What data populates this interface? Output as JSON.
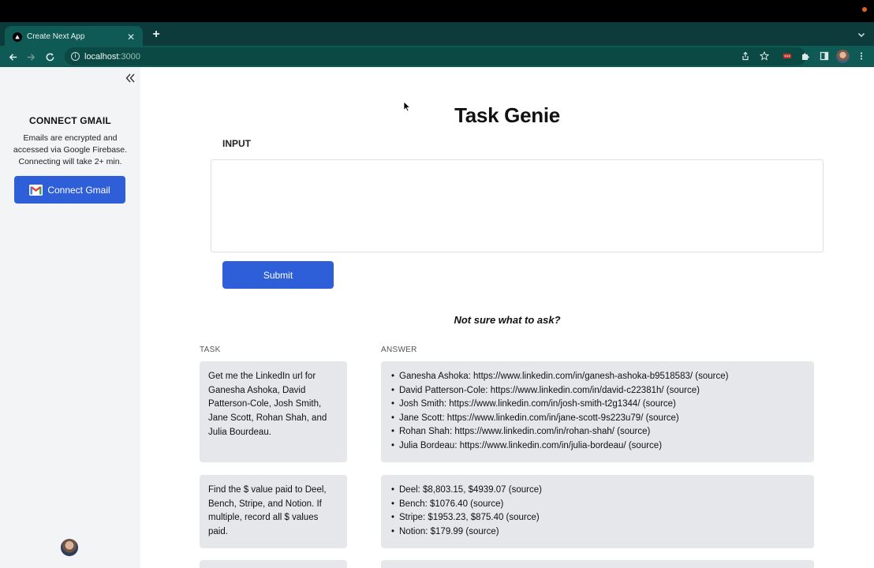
{
  "browser": {
    "tab_title": "Create Next App",
    "url_host": "localhost",
    "url_port": ":3000"
  },
  "sidebar": {
    "title": "CONNECT GMAIL",
    "description": "Emails are encrypted and accessed via Google Firebase. Connecting will take 2+ min.",
    "connect_button": "Connect Gmail"
  },
  "main": {
    "title": "Task Genie",
    "input_label": "INPUT",
    "input_value": "",
    "submit_label": "Submit",
    "hint": "Not sure what to ask?",
    "task_header": "TASK",
    "answer_header": "ANSWER",
    "examples": [
      {
        "task": "Get me the LinkedIn url for Ganesha Ashoka, David Patterson-Cole, Josh Smith, Jane Scott, Rohan Shah, and Julia Bourdeau.",
        "answers": [
          "Ganesha Ashoka: https://www.linkedin.com/in/ganesh-ashoka-b9518583/ (source)",
          "David Patterson-Cole: https://www.linkedin.com/in/david-c22381h/ (source)",
          "Josh Smith: https://www.linkedin.com/in/josh-smith-t2g1344/ (source)",
          "Jane Scott: https://www.linkedin.com/in/jane-scott-9s223u79/ (source)",
          "Rohan Shah: https://www.linkedin.com/in/rohan-shah/ (source)",
          "Julia Bordeau: https://www.linkedin.com/in/julia-bordeau/ (source)"
        ]
      },
      {
        "task": "Find the $ value paid to Deel, Bench, Stripe, and Notion. If multiple, record all $ values paid.",
        "answers": [
          "Deel: $8,803.15, $4939.07 (source)",
          "Bench: $1076.40 (source)",
          "Stripe: $1953.23, $875.40 (source)",
          "Notion: $179.99 (source)"
        ]
      }
    ]
  },
  "colors": {
    "accent": "#2f5fd8",
    "tab_bar": "#0d3b3b",
    "toolbar": "#0f5a55",
    "sidebar_bg": "#f3f4f6",
    "card_bg": "#e5e7eb"
  },
  "icons": [
    "nextjs-favicon",
    "close-icon",
    "plus-icon",
    "chevron-down-icon",
    "back-arrow-icon",
    "forward-arrow-icon",
    "reload-icon",
    "info-icon",
    "share-icon",
    "star-icon",
    "extension-icon",
    "puzzle-icon",
    "sidepanel-icon",
    "more-vert-icon",
    "double-chevron-left-icon",
    "gmail-icon"
  ]
}
